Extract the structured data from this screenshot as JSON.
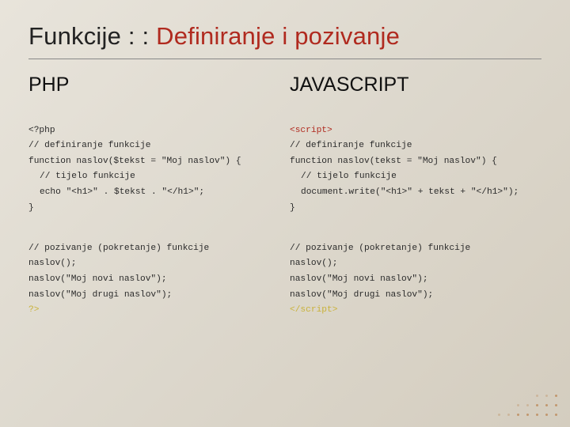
{
  "title": {
    "part_a": "Funkcije",
    "separator": " : : ",
    "part_b": "Definiranje i pozivanje"
  },
  "columns": {
    "left": {
      "heading": "PHP",
      "code": {
        "l1": "<?php",
        "l2": "// definiranje funkcije",
        "l3": "function naslov($tekst = \"Moj naslov\") {",
        "l4": "// tijelo funkcije",
        "l5": "echo \"<h1>\" . $tekst . \"</h1>\";",
        "l6": "}",
        "l7": "// pozivanje (pokretanje) funkcije",
        "l8": "naslov();",
        "l9": "naslov(\"Moj novi naslov\");",
        "l10": "naslov(\"Moj drugi naslov\");",
        "l11": "?>"
      }
    },
    "right": {
      "heading": "JAVASCRIPT",
      "code": {
        "l1": "<script>",
        "l2": "// definiranje funkcije",
        "l3": "function naslov(tekst = \"Moj naslov\") {",
        "l4": "// tijelo funkcije",
        "l5": "document.write(\"<h1>\" + tekst + \"</h1>\");",
        "l6": "}",
        "l7": "// pozivanje (pokretanje) funkcije",
        "l8": "naslov();",
        "l9": "naslov(\"Moj novi naslov\");",
        "l10": "naslov(\"Moj drugi naslov\");",
        "l11": "</script>"
      }
    }
  }
}
